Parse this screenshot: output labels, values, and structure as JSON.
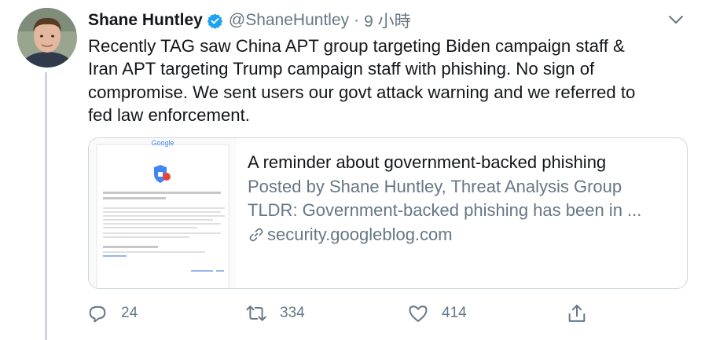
{
  "tweet": {
    "display_name": "Shane Huntley",
    "handle": "@ShaneHuntley",
    "separator": "·",
    "time": "9 小時",
    "text_lines": [
      "Recently TAG saw China APT group targeting Biden campaign staff &",
      "Iran APT targeting Trump campaign staff with phishing. No sign of",
      "compromise. We sent users our govt attack warning and we referred to",
      "fed law enforcement."
    ]
  },
  "card": {
    "title": "A reminder about government-backed phishing",
    "description_line1": "Posted by Shane Huntley, Threat Analysis Group",
    "description_line2": "TLDR: Government-backed phishing has been in ...",
    "domain": "security.googleblog.com",
    "thumbnail_brand": "Google"
  },
  "actions": {
    "reply_count": "24",
    "retweet_count": "334",
    "like_count": "414"
  },
  "icons": {
    "verified": "verified-badge-icon",
    "caret": "chevron-down-icon",
    "link": "link-icon",
    "reply": "reply-icon",
    "retweet": "retweet-icon",
    "like": "heart-icon",
    "share": "share-icon"
  },
  "colors": {
    "text": "#14171a",
    "secondary": "#657786",
    "verified": "#1da1f2",
    "border": "#ccd6dd"
  }
}
